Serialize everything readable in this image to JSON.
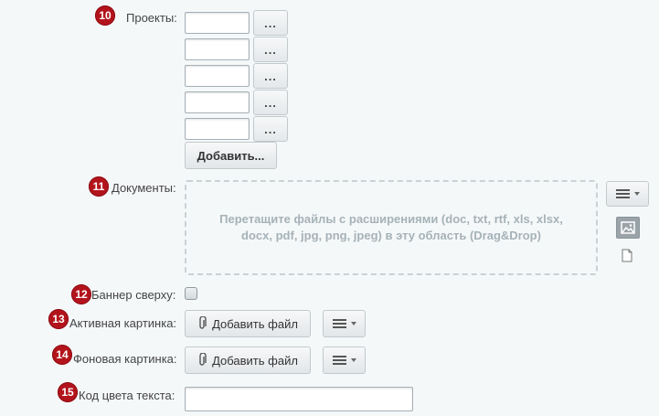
{
  "markers": [
    "10",
    "11",
    "12",
    "13",
    "14",
    "15"
  ],
  "projects": {
    "label": "Проекты:",
    "inputs": [
      "",
      "",
      "",
      "",
      ""
    ],
    "browse_label": "...",
    "add_label": "Добавить..."
  },
  "documents": {
    "label": "Документы:",
    "dropzone_text": "Перетащите файлы с расширениями (doc, txt, rtf, xls, xlsx, docx, pdf, jpg, png, jpeg) в эту область (Drag&Drop)"
  },
  "top_banner": {
    "label": "Баннер сверху:",
    "checked": false
  },
  "active_image": {
    "label": "Активная картинка:",
    "add_file_label": "Добавить файл"
  },
  "background_image": {
    "label": "Фоновая картинка:",
    "add_file_label": "Добавить файл"
  },
  "text_color": {
    "label": "Код цвета текста:",
    "value": ""
  },
  "colors": {
    "marker": "#b3141c",
    "background": "#f5f8f9",
    "dropzone_text": "#a5b2b8"
  }
}
